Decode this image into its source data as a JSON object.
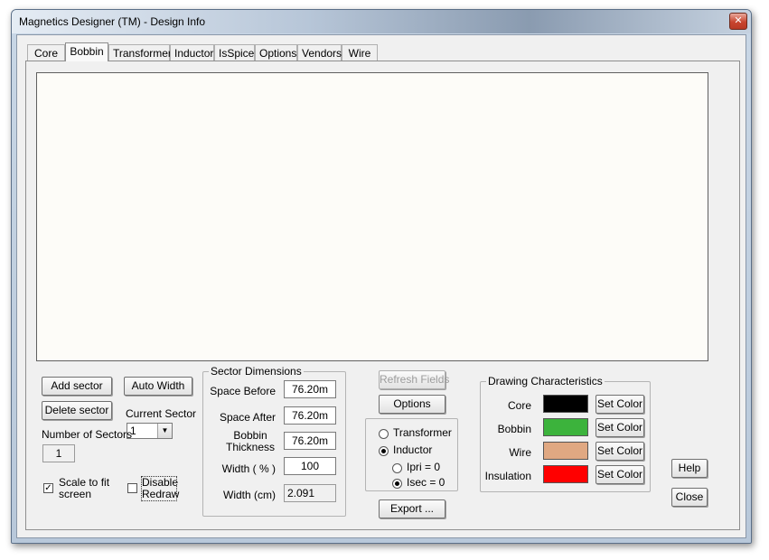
{
  "window": {
    "title": "Magnetics Designer (TM) - Design Info",
    "close_glyph": "✕"
  },
  "tabs": [
    "Core",
    "Bobbin",
    "Transformer",
    "Inductor",
    "IsSpice",
    "Options",
    "Vendors",
    "Wire"
  ],
  "active_tab": "Bobbin",
  "left": {
    "add_sector": "Add sector",
    "auto_width": "Auto Width",
    "delete_sector": "Delete sector",
    "current_sector_label": "Current Sector",
    "current_sector_value": "1",
    "number_of_sectors_label": "Number of Sectors",
    "number_of_sectors_value": "1",
    "scale_to_fit_label": "Scale to fit screen",
    "scale_to_fit_checked": true,
    "disable_redraw_label": "Disable Redraw",
    "disable_redraw_checked": false
  },
  "sector_dimensions": {
    "title": "Sector Dimensions",
    "space_before_label": "Space Before",
    "space_before_value": "76.20m",
    "space_after_label": "Space After",
    "space_after_value": "76.20m",
    "bobbin_thickness_label": "Bobbin Thickness",
    "bobbin_thickness_value": "76.20m",
    "width_pct_label": "Width ( % )",
    "width_pct_value": "100",
    "width_cm_label": "Width (cm)",
    "width_cm_value": "2.091"
  },
  "middle": {
    "refresh_fields": "Refresh Fields",
    "options": "Options",
    "transformer": "Transformer",
    "inductor": "Inductor",
    "ipri": "Ipri = 0",
    "isec": "Isec = 0",
    "selected_type": "Inductor",
    "selected_current": "Isec = 0",
    "export": "Export ..."
  },
  "drawing": {
    "title": "Drawing Characteristics",
    "set_color": "Set Color",
    "items": [
      {
        "label": "Core",
        "color": "#000000"
      },
      {
        "label": "Bobbin",
        "color": "#3cb33c"
      },
      {
        "label": "Wire",
        "color": "#e0a882"
      },
      {
        "label": "Insulation",
        "color": "#ff0000"
      }
    ]
  },
  "right": {
    "help": "Help",
    "close": "Close"
  },
  "colors": {
    "canvas_bg": "#fdfcf8",
    "dialog_bg": "#f0f0f0"
  }
}
